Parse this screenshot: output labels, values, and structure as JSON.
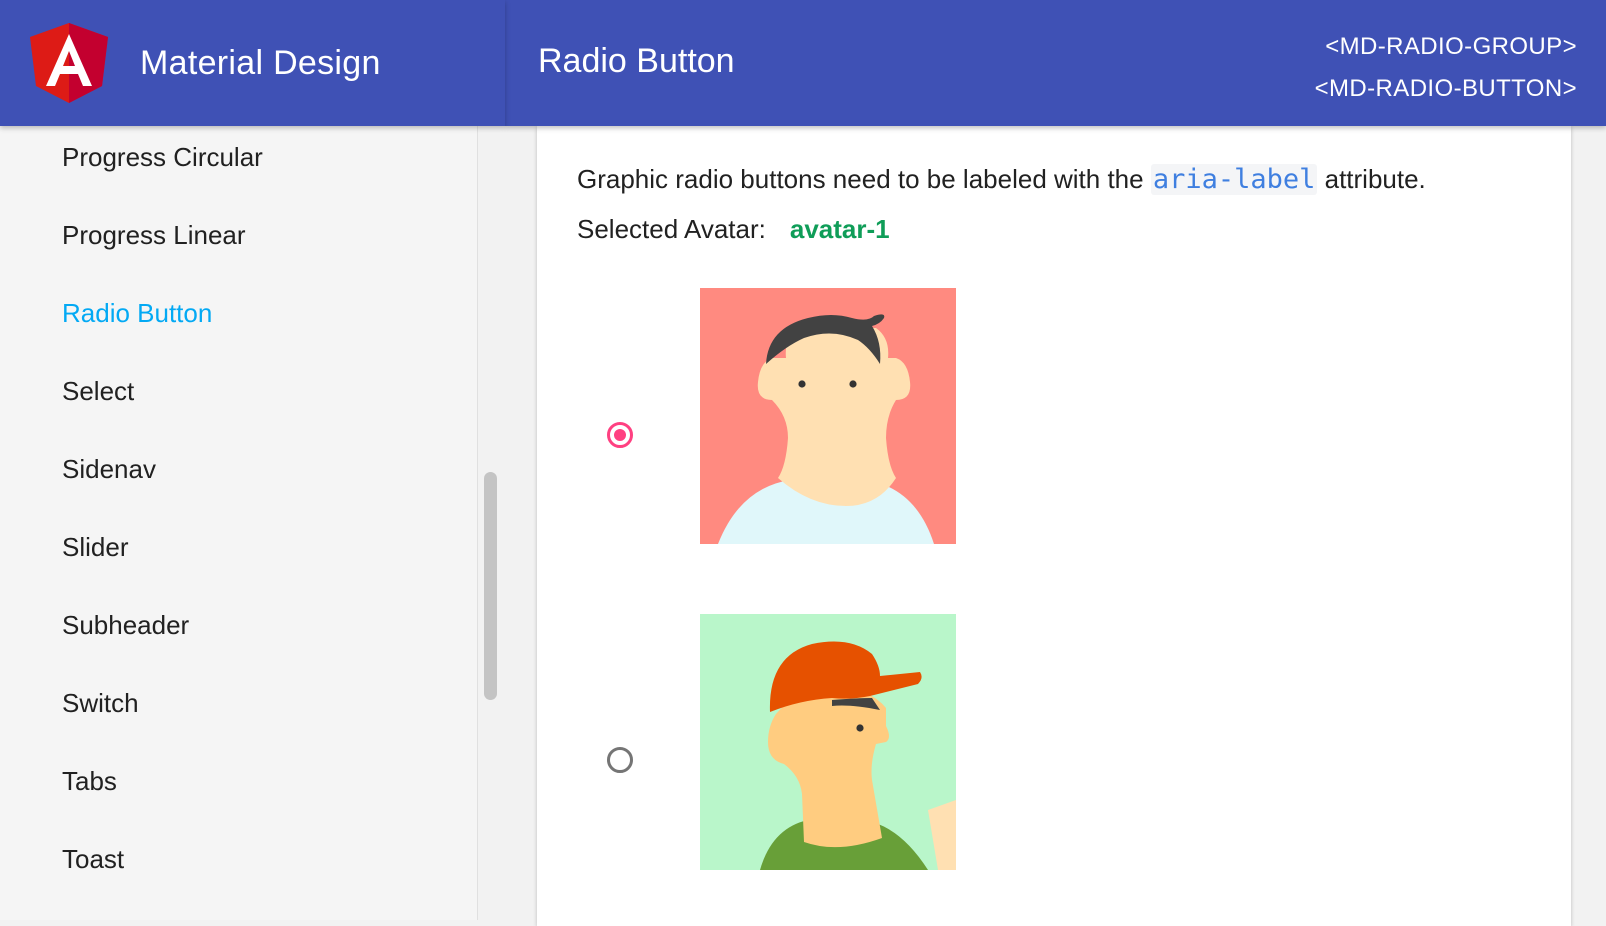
{
  "app": {
    "brand_title": "Material Design"
  },
  "toolbar": {
    "title": "Radio Button",
    "api_links": [
      "<MD-RADIO-GROUP>",
      "<MD-RADIO-BUTTON>"
    ]
  },
  "sidebar": {
    "active_color": "#03a9f4",
    "items": [
      {
        "label": "Progress Circular"
      },
      {
        "label": "Progress Linear"
      },
      {
        "label": "Radio Button",
        "active": true
      },
      {
        "label": "Select"
      },
      {
        "label": "Sidenav"
      },
      {
        "label": "Slider"
      },
      {
        "label": "Subheader"
      },
      {
        "label": "Switch"
      },
      {
        "label": "Tabs"
      },
      {
        "label": "Toast"
      }
    ]
  },
  "content": {
    "description_before": "Graphic radio buttons need to be labeled with the ",
    "description_code": "aria-label",
    "description_after": " attribute.",
    "selected_label": "Selected Avatar:",
    "selected_value": "avatar-1",
    "options": [
      {
        "value": "avatar-1",
        "checked": true,
        "icon": "avatar-boy-icon"
      },
      {
        "value": "avatar-2",
        "checked": false,
        "icon": "avatar-cap-icon"
      }
    ]
  },
  "colors": {
    "primary": "#3f51b5",
    "accent": "#ff4081",
    "selected_value": "#0f9d58"
  }
}
